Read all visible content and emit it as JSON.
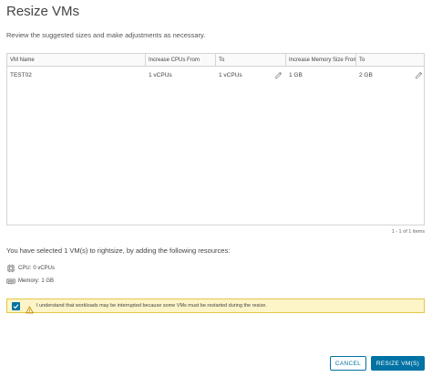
{
  "dialog": {
    "title": "Resize VMs",
    "subtitle": "Review the suggested sizes and make adjustments as necessary."
  },
  "table": {
    "columns": [
      "VM Name",
      "Increase CPUs From",
      "To",
      "Increase Memory Size From",
      "To"
    ],
    "rows": [
      {
        "vm_name": "TEST02",
        "cpu_from": "1 vCPUs",
        "cpu_to": "1 vCPUs",
        "mem_from": "1 GB",
        "mem_to": "2 GB"
      }
    ],
    "footer": "1 - 1 of 1 items"
  },
  "summary": {
    "text": "You have selected 1 VM(s) to rightsize, by adding the following resources:",
    "cpu_label": "CPU:",
    "cpu_value": "0 vCPUs",
    "memory_label": "Memory:",
    "memory_value": "1 GB"
  },
  "acknowledgement": {
    "checked": true,
    "text": "I understand that workloads may be interrupted because some VMs must be restarted during the resize."
  },
  "buttons": {
    "cancel": "CANCEL",
    "resize": "RESIZE VM(S)"
  },
  "colors": {
    "primary": "#0072a3",
    "warning_bg": "#fdf4c8",
    "warning_border": "#e6c74a"
  }
}
